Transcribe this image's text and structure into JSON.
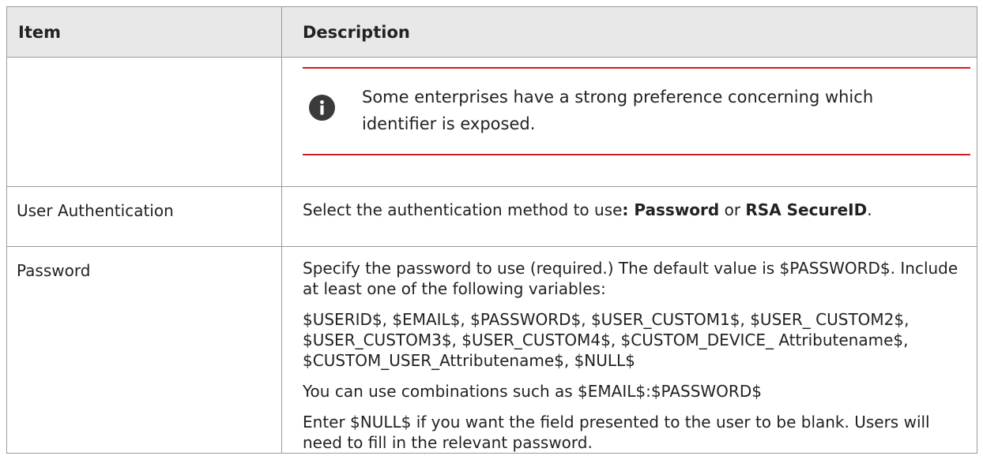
{
  "table": {
    "headers": {
      "item": "Item",
      "description": "Description"
    },
    "note": {
      "icon": "info-icon",
      "text": "Some enterprises have a strong preference concerning which identifier is exposed."
    },
    "rows": [
      {
        "item": "User Authentication",
        "description": {
          "prefix": "Select the authentication method to use",
          "colon": ": ",
          "option1": "Password",
          "or": " or ",
          "option2": "RSA SecureID",
          "suffix": "."
        }
      },
      {
        "item": "Password",
        "paragraphs": [
          "Specify the password to use (required.) The default value is $PASSWORD$. Include at least one of the following variables:",
          "$USERID$, $EMAIL$, $PASSWORD$, $USER_CUSTOM1$, $USER_ CUSTOM2$, $USER_CUSTOM3$, $USER_CUSTOM4$, $CUSTOM_DEVICE_ Attributename$, $CUSTOM_USER_Attributename$, $NULL$",
          "You can use combinations such as $EMAIL$:$PASSWORD$",
          "Enter $NULL$ if you want the field presented to the user to be blank. Users will need to fill in the relevant password."
        ]
      }
    ]
  }
}
